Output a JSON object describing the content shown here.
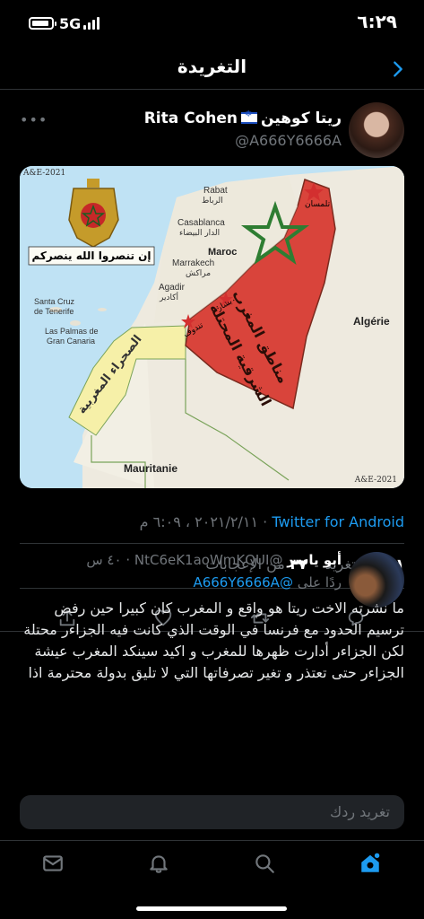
{
  "status_bar": {
    "time": "٦:٢٩",
    "network": "5G"
  },
  "header": {
    "title": "التغريدة"
  },
  "tweet": {
    "display_name": "ريتا كوهين",
    "display_name_latin": "Rita Cohen",
    "handle": "@A666Y6666A",
    "image": {
      "copyright_top": "A&E-2021",
      "copyright_bottom": "A&E-2021",
      "banner_text": "إن تنصروا الله ينصركم",
      "zone_label_1": "مناطق المغرب",
      "zone_label_2": "الشرقية المحتلة",
      "sahara_label": "الصحراء المغربية",
      "places": [
        {
          "id": "rabat",
          "text": "Rabat"
        },
        {
          "id": "rabat-ar",
          "text": "الرباط"
        },
        {
          "id": "casablanca",
          "text": "Casablanca"
        },
        {
          "id": "casablanca-ar",
          "text": "الدار البيضاء"
        },
        {
          "id": "maroc",
          "text": "Maroc"
        },
        {
          "id": "marrakech",
          "text": "Marrakech"
        },
        {
          "id": "marrakech-ar",
          "text": "مراكش"
        },
        {
          "id": "agadir",
          "text": "Agadir"
        },
        {
          "id": "agadir-ar",
          "text": "أكادير"
        },
        {
          "id": "santacruz",
          "text": "Santa Cruz"
        },
        {
          "id": "tenerife",
          "text": "de Tenerife"
        },
        {
          "id": "laspalmas",
          "text": "Las Palmas de"
        },
        {
          "id": "grancanaria",
          "text": "Gran Canaria"
        },
        {
          "id": "algerie",
          "text": "Algérie"
        },
        {
          "id": "mauritanie",
          "text": "Mauritanie"
        },
        {
          "id": "tlemcen",
          "text": "تلمسان"
        },
        {
          "id": "bechar",
          "text": "بشار"
        },
        {
          "id": "tindouf",
          "text": "تندوف"
        }
      ]
    },
    "source": "Twitter for Android",
    "timestamp": "٢٠٢١/٢/١١ ، ٦:٠٩ م",
    "stats": {
      "retweets_count": "١",
      "retweets_label": "إعادة تغريد",
      "likes_count": "٣٧",
      "likes_label": "من الإعجابات"
    }
  },
  "reply": {
    "display_name": "أبو ياسر",
    "handle": "@NtC6eK1aoWmKQUI",
    "time": "٤٠ س",
    "replying_to_label": "ردًا على",
    "replying_to_handle": "@A666Y6666A",
    "text": "ما نشرته الاخت ريتا هو واقع و المغرب كان كبيرا حين رفض ترسيم الحدود مع فرنسا في الوقت الذي كانت فيه الجزاءر محتلة لكن الجزاءر أدارت ظهرها للمغرب و اكيد سينكد المغرب عيشة الجزاءر حتى تعتذر و تغير تصرفاتها التي لا تليق بدولة محترمة اذا"
  },
  "compose": {
    "placeholder": "تغريد ردك"
  },
  "colors": {
    "accent": "#1d9bf0",
    "muted": "#71767b",
    "zone": "#d9443b"
  }
}
